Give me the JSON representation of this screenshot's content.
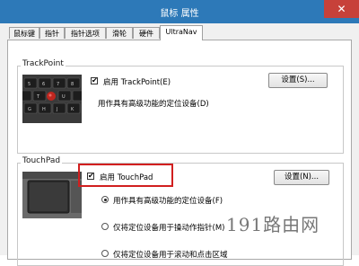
{
  "window": {
    "title": "鼠标 属性",
    "close_glyph": "✕"
  },
  "tabs": [
    {
      "label": "鼠标键"
    },
    {
      "label": "指针"
    },
    {
      "label": "指针选项"
    },
    {
      "label": "滑轮"
    },
    {
      "label": "硬件"
    },
    {
      "label": "UltraNav"
    }
  ],
  "active_tab": "UltraNav",
  "trackpoint": {
    "group_label": "TrackPoint",
    "enable_label": "启用 TrackPoint(E)",
    "enabled": true,
    "description": "用作具有高级功能的定位设备(D)",
    "settings_button": "设置(S)..."
  },
  "touchpad": {
    "group_label": "TouchPad",
    "enable_label": "启用 TouchPad",
    "enabled": true,
    "settings_button": "设置(N)...",
    "options": [
      {
        "label": "用作具有高级功能的定位设备(F)",
        "selected": true
      },
      {
        "label": "仅将定位设备用于操动作指针(M)",
        "selected": false
      },
      {
        "label": "仅将定位设备用于滚动和点击区域",
        "selected": false
      }
    ]
  },
  "watermark": "191路由网",
  "colors": {
    "titlebar": "#2d79b8",
    "close": "#c7413a",
    "highlight": "#d11f1f"
  },
  "icons": {
    "check": "✔"
  }
}
